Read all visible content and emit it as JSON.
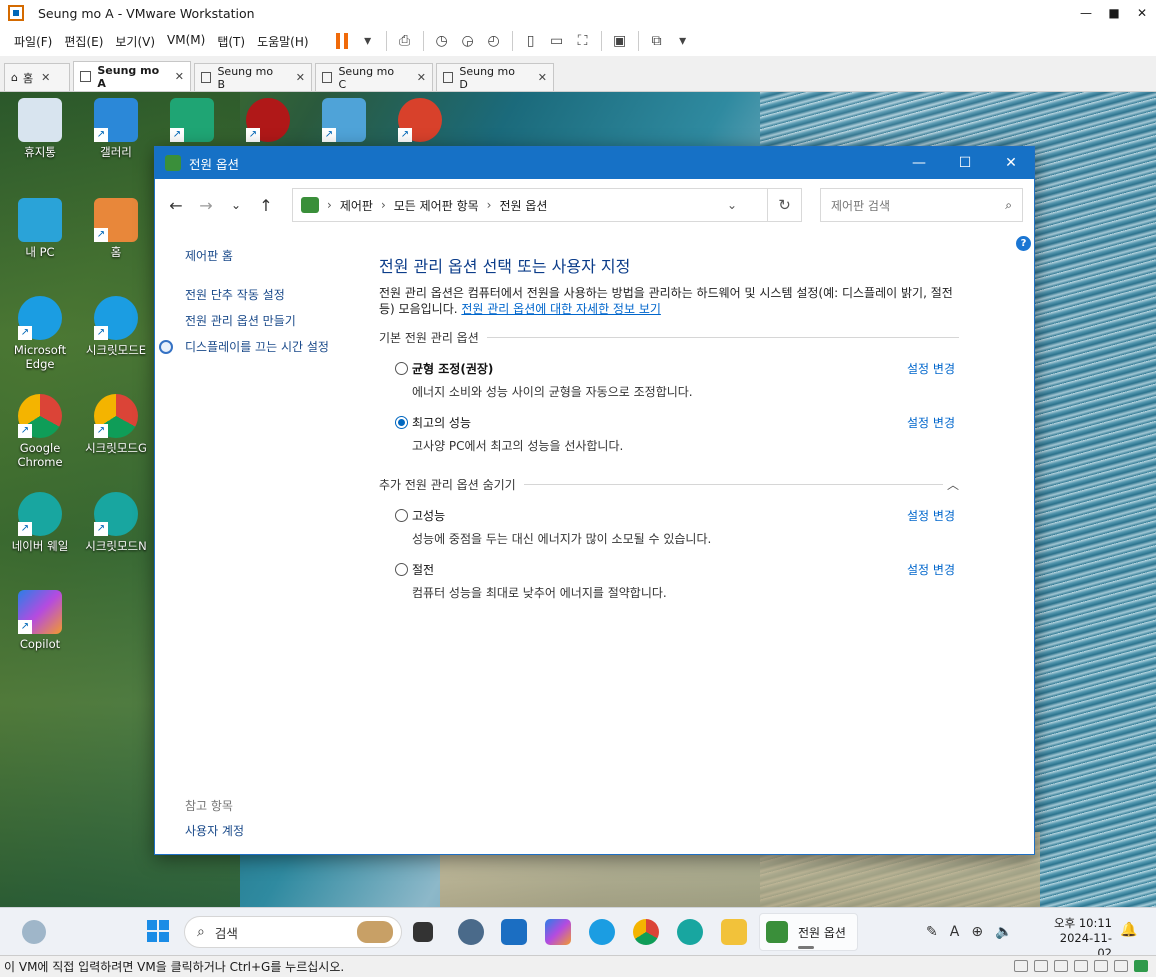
{
  "vmware": {
    "title": "Seung mo A - VMware Workstation",
    "menu": [
      "파일(F)",
      "편집(E)",
      "보기(V)",
      "VM(M)",
      "탭(T)",
      "도움말(H)"
    ],
    "tabs": [
      {
        "label": "홈",
        "icon": "home-icon"
      },
      {
        "label": "Seung mo A",
        "active": true
      },
      {
        "label": "Seung mo B"
      },
      {
        "label": "Seung mo C"
      },
      {
        "label": "Seung mo D"
      }
    ],
    "status": "이 VM에 직접 입력하려면 VM을 클릭하거나 Ctrl+G를 누르십시오."
  },
  "desktop": {
    "icons": [
      {
        "label": "휴지통",
        "icon": "recycle-bin-icon"
      },
      {
        "label": "갤러리",
        "icon": "gallery-icon"
      },
      {
        "label": "",
        "icon": "downloads-folder-icon"
      },
      {
        "label": "",
        "icon": "game-app-icon"
      },
      {
        "label": "",
        "icon": "revo-uninstaller-icon"
      },
      {
        "label": "",
        "icon": "ccleaner-icon"
      },
      {
        "label": "내 PC",
        "icon": "this-pc-icon"
      },
      {
        "label": "홈",
        "icon": "home-icon"
      },
      {
        "label": "Microsoft Edge",
        "icon": "edge-icon"
      },
      {
        "label": "시크릿모드E",
        "icon": "edge-icon"
      },
      {
        "label": "Google Chrome",
        "icon": "chrome-icon"
      },
      {
        "label": "시크릿모드G",
        "icon": "chrome-icon"
      },
      {
        "label": "네이버 웨일",
        "icon": "whale-icon"
      },
      {
        "label": "시크릿모드N",
        "icon": "whale-icon"
      },
      {
        "label": "Copilot",
        "icon": "copilot-icon"
      }
    ]
  },
  "window": {
    "title": "전원 옵션",
    "breadcrumb": [
      "제어판",
      "모든 제어판 항목",
      "전원 옵션"
    ],
    "search_placeholder": "제어판 검색",
    "sidebar": {
      "home": "제어판 홈",
      "links": [
        "전원 단추 작동 설정",
        "전원 관리 옵션 만들기",
        "디스플레이를 끄는 시간 설정"
      ],
      "see_also_header": "참고 항목",
      "see_also": [
        "사용자 계정"
      ]
    },
    "main": {
      "heading": "전원 관리 옵션 선택 또는 사용자 지정",
      "description": "전원 관리 옵션은 컴퓨터에서 전원을 사용하는 방법을 관리하는 하드웨어 및 시스템 설정(예: 디스플레이 밝기, 절전 등) 모음입니다. ",
      "description_link": "전원 관리 옵션에 대한 자세한 정보 보기",
      "group_basic": "기본 전원 관리 옵션",
      "group_more": "추가 전원 관리 옵션 숨기기",
      "change_label": "설정 변경",
      "plans_basic": [
        {
          "name": "균형 조정(권장)",
          "desc": "에너지 소비와 성능 사이의 균형을 자동으로 조정합니다.",
          "selected": false,
          "bold": true
        },
        {
          "name": "최고의 성능",
          "desc": "고사양 PC에서 최고의 성능을 선사합니다.",
          "selected": true,
          "bold": false
        }
      ],
      "plans_more": [
        {
          "name": "고성능",
          "desc": "성능에 중점을 두는 대신 에너지가 많이 소모될 수 있습니다.",
          "selected": false
        },
        {
          "name": "절전",
          "desc": "컴퓨터 성능을 최대로 낮추어 에너지를 절약합니다.",
          "selected": false
        }
      ]
    }
  },
  "taskbar": {
    "search_placeholder": "검색",
    "active_app": "전원 옵션",
    "time_ampm": "오후 10:11",
    "date": "2024-11-02",
    "ime": "A"
  },
  "colors": {
    "accent": "#1671c6",
    "link": "#0066cc",
    "heading": "#0c3d8a",
    "pause": "#f06a0a"
  }
}
